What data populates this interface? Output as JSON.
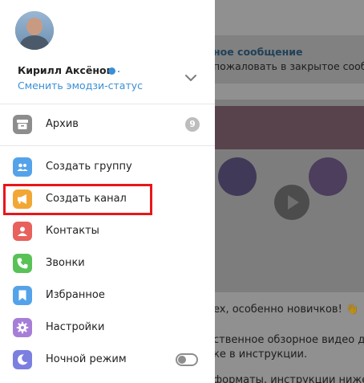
{
  "background_chat": {
    "pinned_title": "ное сообщение",
    "pinned_text": "пожаловать в закрытое сообщ",
    "message_text_1": "ex, особенно новичков! 👋",
    "message_text_2": "ственное обзорное видео для",
    "message_text_3": "ке в инструкции.",
    "message_text_4": "форматы, инструкции ниже"
  },
  "profile": {
    "name": "Кирилл Аксёнов",
    "emoji_status_link": "Сменить эмодзи-статус"
  },
  "menu": {
    "archive": {
      "label": "Архив",
      "badge": "9",
      "icon_color": "#8d8d8d"
    },
    "create_group": {
      "label": "Создать группу",
      "icon_color": "#54a3ea"
    },
    "create_channel": {
      "label": "Создать канал",
      "icon_color": "#f2a735"
    },
    "contacts": {
      "label": "Контакты",
      "icon_color": "#e8615c"
    },
    "calls": {
      "label": "Звонки",
      "icon_color": "#58c257"
    },
    "saved": {
      "label": "Избранное",
      "icon_color": "#54a3ea"
    },
    "settings": {
      "label": "Настройки",
      "icon_color": "#a67ed8"
    },
    "night_mode": {
      "label": "Ночной режим",
      "icon_color": "#7b7fe0",
      "enabled": false
    }
  },
  "colors": {
    "accent": "#3a8fd6",
    "highlight": "#e8161b"
  }
}
